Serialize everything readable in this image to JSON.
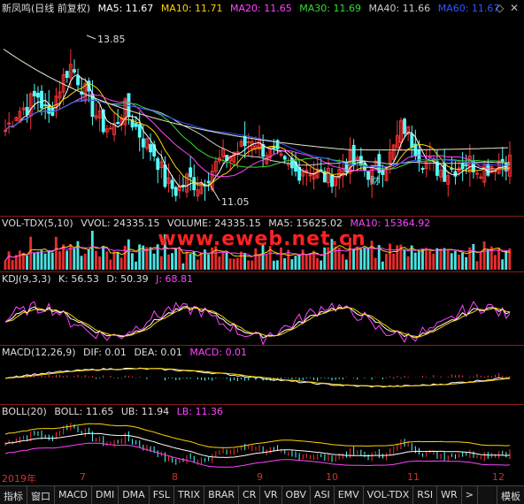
{
  "main": {
    "title": "新凤鸣(日线 前复权)",
    "ma": [
      {
        "label": "MA5: 11.67",
        "color": "#ffffff"
      },
      {
        "label": "MA10: 11.71",
        "color": "#ffd400"
      },
      {
        "label": "MA20: 11.65",
        "color": "#ff44ff"
      },
      {
        "label": "MA30: 11.69",
        "color": "#33dd33"
      },
      {
        "label": "MA40: 11.66",
        "color": "#cccccc"
      },
      {
        "label": "MA60: 11.67",
        "color": "#3355ff"
      }
    ],
    "high_label": "13.85",
    "low_label": "11.05",
    "marker_label": "财"
  },
  "volume": {
    "name": "VOL-TDX(5,10)",
    "items": [
      {
        "label": "VVOL: 24335.15",
        "color": "#dddddd"
      },
      {
        "label": "VOLUME: 24335.15",
        "color": "#dddddd"
      },
      {
        "label": "MA5: 15625.02",
        "color": "#dddddd"
      },
      {
        "label": "MA10: 15364.92",
        "color": "#ff44ff"
      }
    ]
  },
  "watermark": "www.eweb.net.cn",
  "kdj": {
    "name": "KDJ(9,3,3)",
    "items": [
      {
        "label": "K: 56.53",
        "color": "#dddddd"
      },
      {
        "label": "D: 50.39",
        "color": "#dddddd"
      },
      {
        "label": "J: 68.81",
        "color": "#ff44ff"
      }
    ]
  },
  "macd": {
    "name": "MACD(12,26,9)",
    "items": [
      {
        "label": "DIF: 0.01",
        "color": "#dddddd"
      },
      {
        "label": "DEA: 0.01",
        "color": "#dddddd"
      },
      {
        "label": "MACD: 0.01",
        "color": "#ff44ff"
      }
    ]
  },
  "boll": {
    "name": "BOLL(20)",
    "items": [
      {
        "label": "BOLL: 11.65",
        "color": "#dddddd"
      },
      {
        "label": "UB: 11.94",
        "color": "#dddddd"
      },
      {
        "label": "LB: 11.36",
        "color": "#ff44ff"
      }
    ]
  },
  "x_axis": {
    "labels": [
      "2019年",
      "7",
      "8",
      "9",
      "10",
      "11",
      "12"
    ]
  },
  "tabs": [
    "指标",
    "窗口",
    "MACD",
    "DMI",
    "DMA",
    "FSL",
    "TRIX",
    "BRAR",
    "CR",
    "VR",
    "OBV",
    "ASI",
    "EMV",
    "VOL-TDX",
    "RSI",
    "WR",
    ">",
    "模板"
  ],
  "colors": {
    "up": "#ff3232",
    "down": "#54fcfc",
    "bg": "#000000"
  },
  "chart_data": {
    "type": "candlestick",
    "x": [
      "2019-06",
      "2019-07",
      "2019-08",
      "2019-09",
      "2019-10",
      "2019-11",
      "2019-12"
    ],
    "close_series": [
      12.2,
      12.5,
      12.6,
      12.8,
      12.4,
      12.9,
      13.3,
      13.0,
      12.6,
      12.3,
      12.2,
      12.6,
      12.3,
      12.0,
      11.8,
      11.3,
      11.2,
      11.4,
      11.3,
      11.5,
      11.7,
      11.8,
      11.9,
      12.1,
      11.9,
      11.8,
      11.6,
      11.5,
      11.6,
      11.5,
      11.4,
      11.5,
      11.7,
      11.6,
      11.5,
      11.6,
      11.8,
      12.3,
      12.0,
      11.7,
      11.6,
      11.5,
      11.6,
      11.7,
      11.6,
      11.6,
      11.7,
      11.7
    ],
    "high": 13.85,
    "low": 11.05,
    "ma": {
      "MA5": 11.67,
      "MA10": 11.71,
      "MA20": 11.65,
      "MA30": 11.69,
      "MA40": 11.66,
      "MA60": 11.67
    },
    "volume": {
      "VVOL": 24335.15,
      "VOLUME": 24335.15,
      "MA5": 15625.02,
      "MA10": 15364.92
    },
    "kdj": {
      "K": 56.53,
      "D": 50.39,
      "J": 68.81
    },
    "macd": {
      "DIF": 0.01,
      "DEA": 0.01,
      "MACD": 0.01
    },
    "boll": {
      "BOLL": 11.65,
      "UB": 11.94,
      "LB": 11.36
    }
  }
}
